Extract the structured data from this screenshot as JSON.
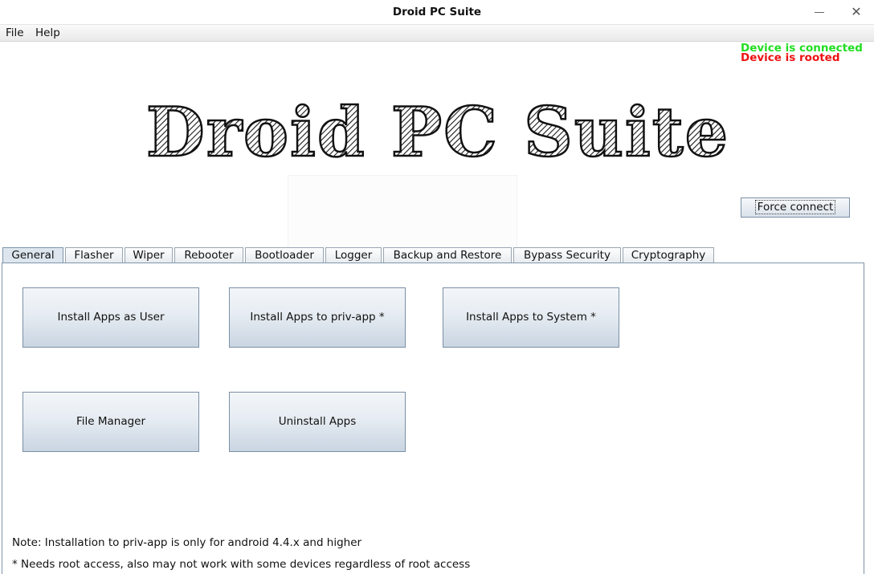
{
  "window": {
    "title": "Droid PC Suite"
  },
  "menu": {
    "file": "File",
    "help": "Help"
  },
  "status": {
    "connected": "Device is connected",
    "rooted": "Device is rooted",
    "connected_color": "#22dd22",
    "rooted_color": "#ee1111"
  },
  "logo": {
    "text": "Droid PC Suite"
  },
  "force_connect": "Force connect",
  "tabs": [
    "General",
    "Flasher",
    "Wiper",
    "Rebooter",
    "Bootloader",
    "Logger",
    "Backup and Restore",
    "Bypass Security",
    "Cryptography"
  ],
  "active_tab": "General",
  "buttons": {
    "install_user": "Install Apps as User",
    "install_priv": "Install Apps to priv-app *",
    "install_system": "Install Apps to System *",
    "file_manager": "File Manager",
    "uninstall": "Uninstall Apps"
  },
  "notes": {
    "note1": "Note: Installation to priv-app is only for android 4.4.x and higher",
    "note2": "* Needs root access, also may not work with some devices regardless of root access"
  }
}
